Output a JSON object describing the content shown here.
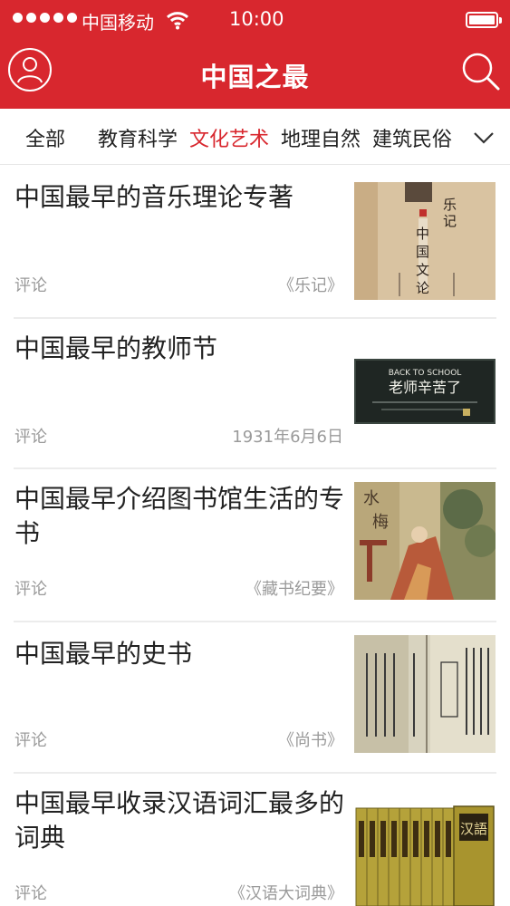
{
  "status_bar": {
    "carrier": "中国移动",
    "time": "10:00",
    "signal_icon": "signal-dots-icon",
    "wifi_icon": "wifi-icon",
    "battery_icon": "battery-icon"
  },
  "nav": {
    "title": "中国之最",
    "left_icon": "user-icon",
    "right_icon": "search-icon",
    "brand_color": "#d8272e"
  },
  "tabs": {
    "items": [
      "全部",
      "教育科学",
      "文化艺术",
      "地理自然",
      "建筑民俗"
    ],
    "active_index": 2,
    "active_color": "#d8272e",
    "more_icon": "chevron-down-icon"
  },
  "articles": [
    {
      "title": "中国最早的音乐理论专著",
      "tag": "评论",
      "source": "《乐记》",
      "thumb": "book-cover-image"
    },
    {
      "title": "中国最早的教师节",
      "tag": "评论",
      "source": "1931年6月6日",
      "thumb": "chalkboard-image",
      "thumb_text_line1": "BACK TO SCHOOL",
      "thumb_text_line2": "老师辛苦了"
    },
    {
      "title": "中国最早介绍图书馆生活的专书",
      "tag": "评论",
      "source": "《藏书纪要》",
      "thumb": "painting-image"
    },
    {
      "title": "中国最早的史书",
      "tag": "评论",
      "source": "《尚书》",
      "thumb": "old-book-page-image"
    },
    {
      "title": "中国最早收录汉语词汇最多的词典",
      "tag": "评论",
      "source": "《汉语大词典》",
      "thumb": "dictionary-set-image"
    }
  ]
}
